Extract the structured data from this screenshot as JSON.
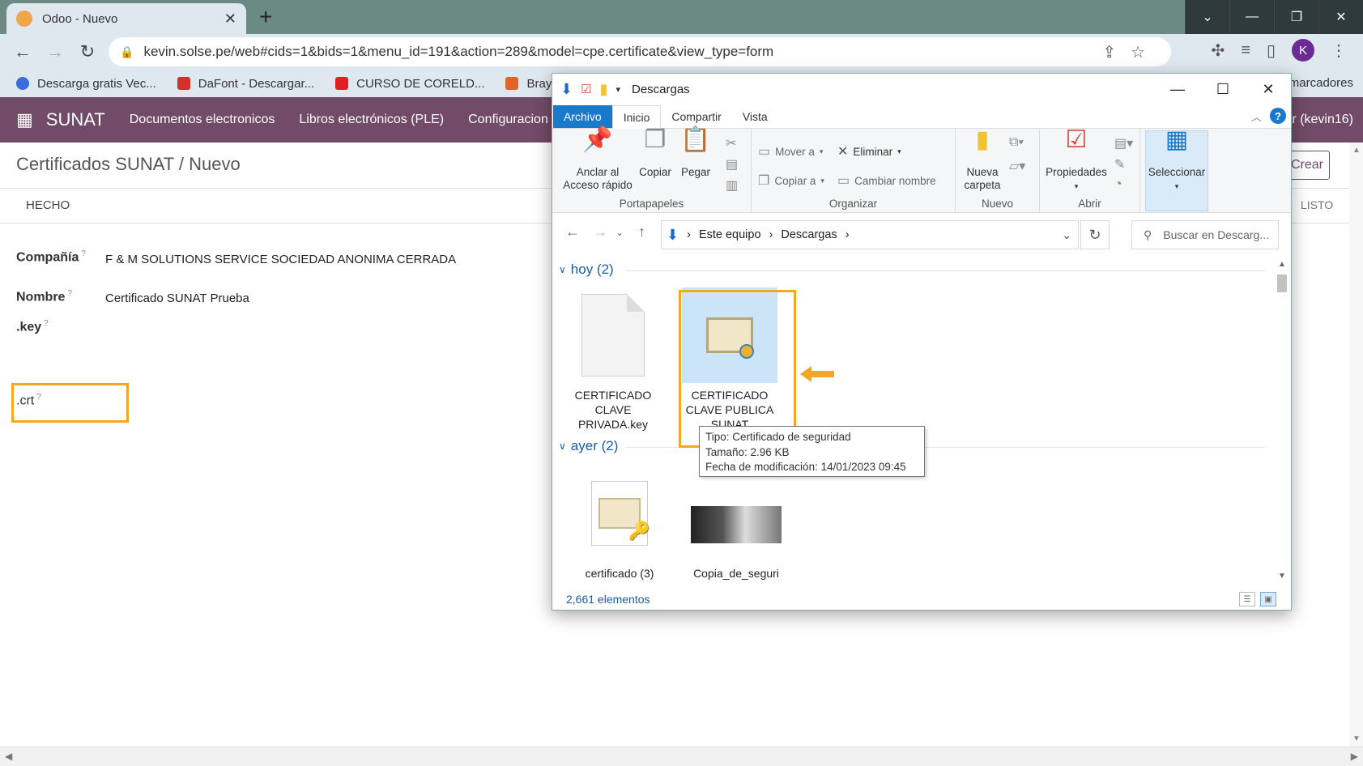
{
  "browser": {
    "tab_title": "Odoo - Nuevo",
    "url": "kevin.solse.pe/web#cids=1&bids=1&menu_id=191&action=289&model=cpe.certificate&view_type=form",
    "avatar_letter": "K",
    "bookmarks": [
      {
        "label": "Descarga gratis Vec...",
        "color": "#3b6cd9"
      },
      {
        "label": "DaFont - Descargar...",
        "color": "#d6302a"
      },
      {
        "label": "CURSO DE CORELD...",
        "color": "#e02020"
      },
      {
        "label": "Brayan Me",
        "color": "#e2632a"
      }
    ],
    "bookmarks_right": "marcadores"
  },
  "odoo": {
    "app_name": "SUNAT",
    "menus": [
      "Documentos electronicos",
      "Libros electrónicos (PLE)",
      "Configuracion"
    ],
    "user": "r (kevin16)",
    "breadcrumb": "Certificados SUNAT / Nuevo",
    "create_label": "Crear",
    "done_label": "HECHO",
    "ready_label": "LISTO",
    "fields": {
      "company_label": "Compañía",
      "company_value": "F & M SOLUTIONS SERVICE SOCIEDAD ANONIMA CERRADA",
      "name_label": "Nombre",
      "name_value": "Certificado SUNAT Prueba",
      "key_label": ".key",
      "crt_label": ".crt",
      "help_mark": "?"
    }
  },
  "explorer": {
    "title": "Descargas",
    "tabs": [
      "Archivo",
      "Inicio",
      "Compartir",
      "Vista"
    ],
    "ribbon": {
      "pin": "Anclar al Acceso rápido",
      "copy": "Copiar",
      "paste": "Pegar",
      "clipboard_group": "Portapapeles",
      "move_to": "Mover a",
      "copy_to": "Copiar a",
      "delete": "Eliminar",
      "rename": "Cambiar nombre",
      "organize_group": "Organizar",
      "new_folder": "Nueva carpeta",
      "new_group": "Nuevo",
      "properties": "Propiedades",
      "open_group": "Abrir",
      "select": "Seleccionar"
    },
    "address": [
      "Este equipo",
      "Descargas"
    ],
    "search_placeholder": "Buscar en Descarg...",
    "groups": [
      {
        "label": "hoy (2)"
      },
      {
        "label": "ayer (2)"
      }
    ],
    "files": [
      {
        "name": "CERTIFICADO CLAVE PRIVADA.key",
        "icon": "key-file-icon"
      },
      {
        "name": "CERTIFICADO CLAVE PUBLICA SUNAT",
        "icon": "certificate-icon",
        "selected": true
      },
      {
        "name": "certificado (3)",
        "icon": "certificate-key-icon"
      },
      {
        "name": "Copia_de_seguri",
        "icon": "photo-thumbnail"
      }
    ],
    "tooltip": {
      "type": "Tipo: Certificado de seguridad",
      "size": "Tamaño: 2.96 KB",
      "modified": "Fecha de modificación: 14/01/2023 09:45"
    },
    "status": "2,661 elementos"
  },
  "colors": {
    "odoo_primary": "#714b67",
    "highlight": "#f5a623",
    "windows_blue": "#1979ca"
  }
}
